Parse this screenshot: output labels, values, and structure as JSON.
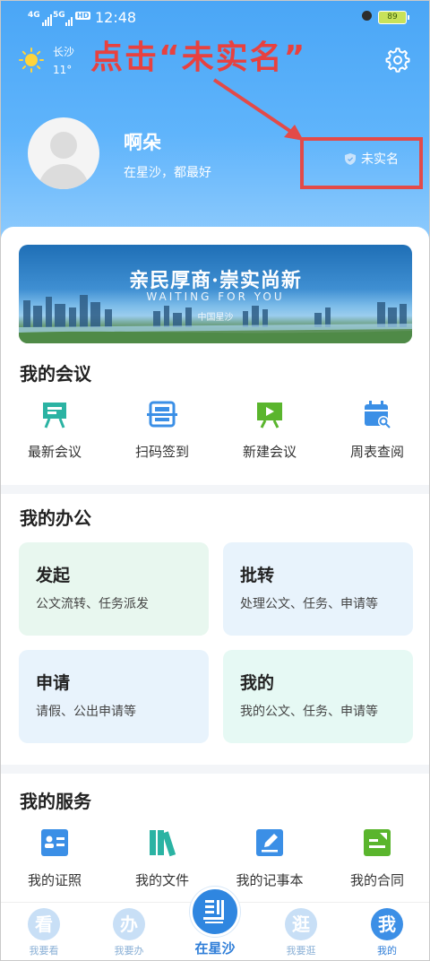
{
  "status_bar": {
    "signal": "4G",
    "signal2": "5G",
    "hd": "HD",
    "time": "12:48",
    "battery": "89"
  },
  "weather": {
    "city": "长沙",
    "temperature": "11°",
    "icon": "sun-icon"
  },
  "annotation": {
    "text": "点击“未实名”",
    "color": "#e8413f"
  },
  "profile": {
    "name": "啊朵",
    "slogan": "在星沙，都最好",
    "verify_status": "未实名"
  },
  "banner": {
    "title": "亲民厚商·崇实尚新",
    "subtitle": "WAITING FOR YOU",
    "caption": "中国星沙"
  },
  "meetings": {
    "title": "我的会议",
    "items": [
      {
        "label": "最新会议",
        "icon": "easel-icon",
        "color": "#2bb3a3"
      },
      {
        "label": "扫码签到",
        "icon": "scan-icon",
        "color": "#3b8fe6"
      },
      {
        "label": "新建会议",
        "icon": "presentation-icon",
        "color": "#5ab52d"
      },
      {
        "label": "周表查阅",
        "icon": "calendar-search-icon",
        "color": "#3b8fe6"
      }
    ]
  },
  "office": {
    "title": "我的办公",
    "cards": [
      {
        "title": "发起",
        "desc": "公文流转、任务派发",
        "bg": "#e8f7ef"
      },
      {
        "title": "批转",
        "desc": "处理公文、任务、申请等",
        "bg": "#e8f3fc"
      },
      {
        "title": "申请",
        "desc": "请假、公出申请等",
        "bg": "#e8f3fc"
      },
      {
        "title": "我的",
        "desc": "我的公文、任务、申请等",
        "bg": "#e6f9f4"
      }
    ]
  },
  "services": {
    "title": "我的服务",
    "items": [
      {
        "label": "我的证照",
        "icon": "id-card-icon",
        "color": "#3b8fe6"
      },
      {
        "label": "我的文件",
        "icon": "books-icon",
        "color": "#2bb3a3"
      },
      {
        "label": "我的记事本",
        "icon": "edit-note-icon",
        "color": "#3b8fe6"
      },
      {
        "label": "我的合同",
        "icon": "contract-icon",
        "color": "#5ab52d"
      }
    ]
  },
  "tabbar": {
    "tabs": [
      {
        "glyph": "看",
        "label": "我要看"
      },
      {
        "glyph": "办",
        "label": "我要办"
      },
      {
        "glyph": "",
        "label": "在星沙"
      },
      {
        "glyph": "逛",
        "label": "我要逛"
      },
      {
        "glyph": "我",
        "label": "我的"
      }
    ],
    "active_index": 4,
    "accent": "#2f86e0"
  }
}
